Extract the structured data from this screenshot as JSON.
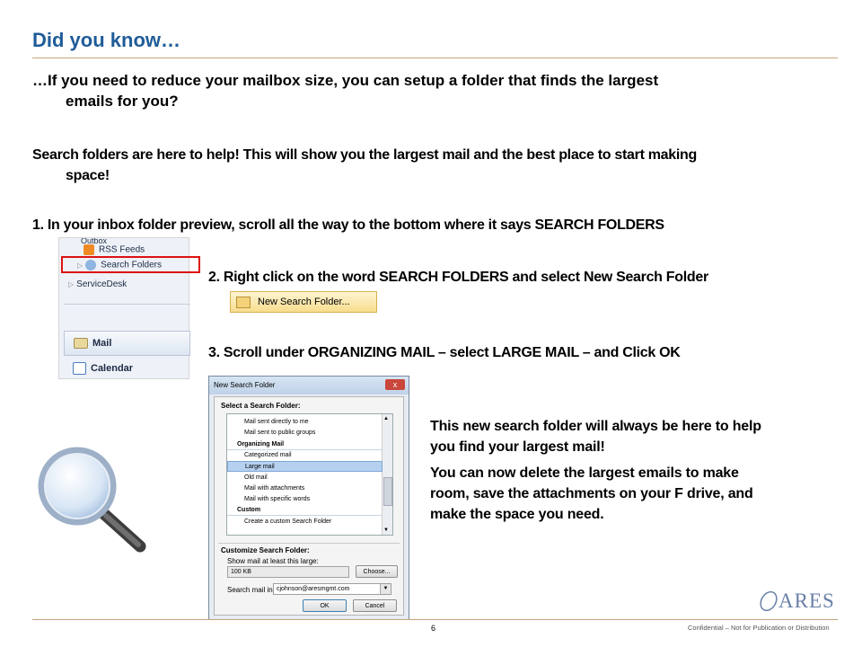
{
  "title": "Did you know…",
  "intro": {
    "line1": "…If you need to reduce your mailbox size, you can setup a folder that finds the largest",
    "line2": "emails for you?"
  },
  "help": {
    "line1": "Search folders are here to help! This will show you the largest mail and the best place to start making",
    "line2": "space!"
  },
  "step1": "1. In your inbox folder preview, scroll all the way to the bottom where it says SEARCH FOLDERS",
  "step2": "2. Right click on the word SEARCH FOLDERS and select New Search Folder",
  "step3": "3. Scroll under ORGANIZING MAIL – select LARGE MAIL – and Click OK",
  "nav": {
    "outbox": "Outbox",
    "rss": "RSS Feeds",
    "search_folders": "Search Folders",
    "servicedesk": "ServiceDesk",
    "mail": "Mail",
    "calendar": "Calendar"
  },
  "context_menu": {
    "new_search_folder": "New Search Folder..."
  },
  "dialog": {
    "title": "New Search Folder",
    "close": "x",
    "select_label": "Select a Search Folder:",
    "items": [
      {
        "text": "Mail sent directly to me",
        "kind": "item"
      },
      {
        "text": "Mail sent to public groups",
        "kind": "item"
      },
      {
        "text": "Organizing Mail",
        "kind": "header"
      },
      {
        "text": "Categorized mail",
        "kind": "item"
      },
      {
        "text": "Large mail",
        "kind": "selected"
      },
      {
        "text": "Old mail",
        "kind": "item"
      },
      {
        "text": "Mail with attachments",
        "kind": "item"
      },
      {
        "text": "Mail with specific words",
        "kind": "item"
      },
      {
        "text": "Custom",
        "kind": "header"
      },
      {
        "text": "Create a custom Search Folder",
        "kind": "item"
      }
    ],
    "customize_label": "Customize Search Folder:",
    "show_mail_label": "Show mail at least this large:",
    "size_value": "100 KB",
    "choose_button": "Choose...",
    "search_in_label": "Search mail in:",
    "search_in_value": "cjohnson@aresmgmt.com",
    "ok": "OK",
    "cancel": "Cancel"
  },
  "note": {
    "p1_line1": "This new search folder will always be here to help",
    "p1_line2": "you find your largest mail!",
    "p2_line1": "You can now delete the largest emails to make",
    "p2_line2": "room, save the attachments on your F drive, and",
    "p2_line3": "make the space you need."
  },
  "logo": "ARES",
  "page_number": "6",
  "confidential": "Confidential  – Not for Publication or Distribution",
  "colors": {
    "title": "#1f5c99",
    "rule": "#c8a37b",
    "highlight": "#dd1111",
    "logo": "#6a7fa8"
  }
}
